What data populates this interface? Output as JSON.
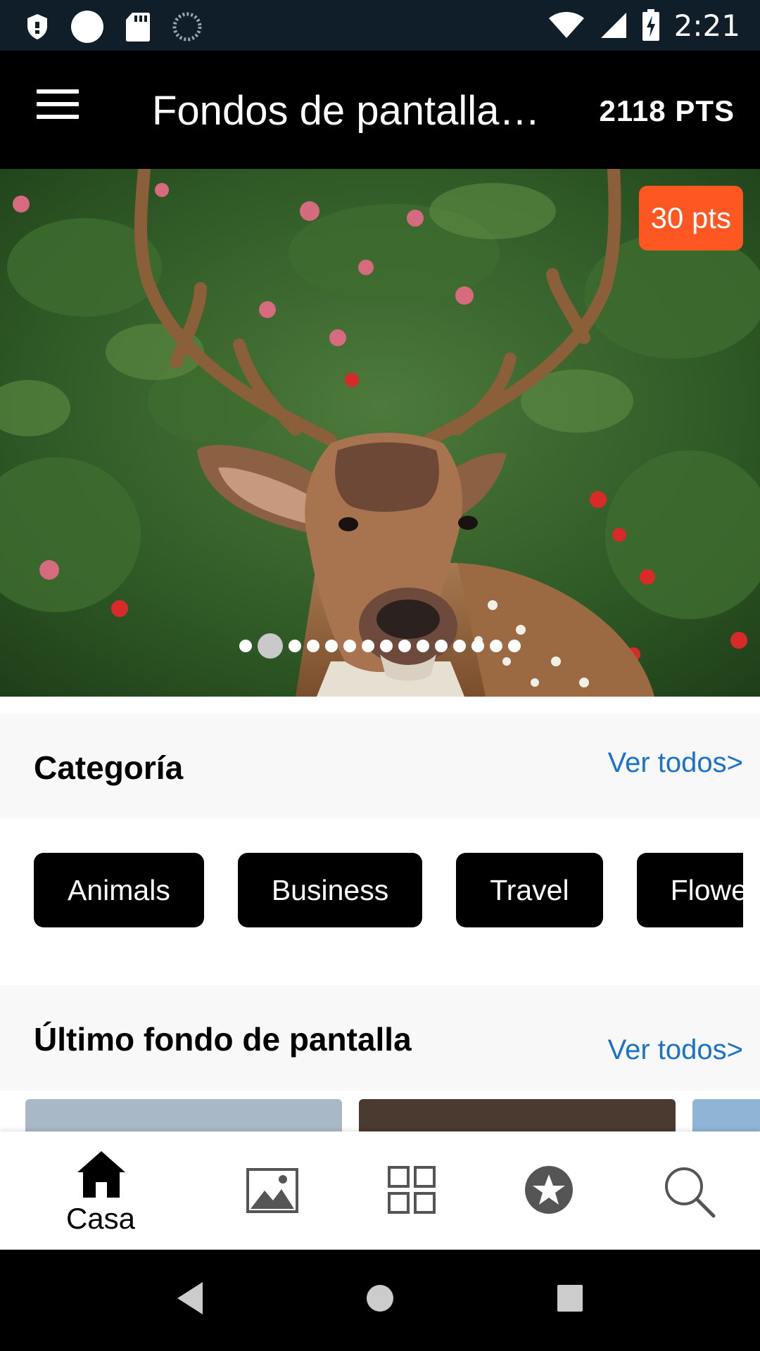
{
  "status_bar": {
    "time": "2:21",
    "icons": [
      "shield-icon",
      "circle-notification-icon",
      "sd-card-icon",
      "sync-icon",
      "wifi-icon",
      "cell-signal-icon",
      "battery-charging-icon"
    ]
  },
  "app_bar": {
    "title": "Fondos de pantalla…",
    "points": "2118 PTS",
    "menu_icon": "hamburger-menu-icon"
  },
  "hero": {
    "image": "deer-in-foliage",
    "badge": "30 pts",
    "slide_count": 15,
    "active_slide": 1
  },
  "category": {
    "title": "Categoría",
    "see_all": "Ver todos>",
    "items": [
      "Animals",
      "Business",
      "Travel",
      "Flowers"
    ]
  },
  "latest": {
    "title": "Último fondo de pantalla",
    "see_all": "Ver todos>"
  },
  "bottom_nav": {
    "items": [
      {
        "icon": "home-icon",
        "label": "Casa",
        "active": true
      },
      {
        "icon": "image-icon",
        "label": "",
        "active": false
      },
      {
        "icon": "grid-icon",
        "label": "",
        "active": false
      },
      {
        "icon": "star-badge-icon",
        "label": "",
        "active": false
      },
      {
        "icon": "search-icon",
        "label": "",
        "active": false
      }
    ]
  },
  "system_nav": [
    "back-icon",
    "home-circle-icon",
    "recents-icon"
  ],
  "colors": {
    "accent": "#1a73c8",
    "badge": "#ff5722",
    "chip": "#000000",
    "status_bar": "#0f1e28"
  }
}
